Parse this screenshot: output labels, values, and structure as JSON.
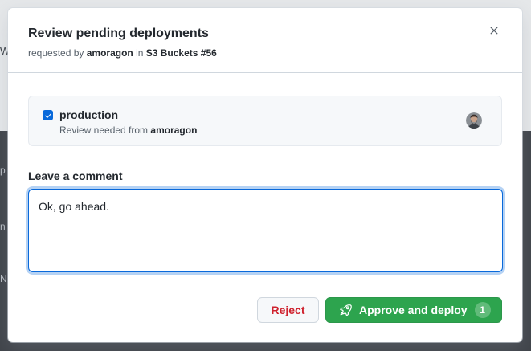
{
  "modal": {
    "title": "Review pending deployments",
    "subtitle": {
      "prefix": "requested by ",
      "user": "amoragon",
      "middle": " in ",
      "workflow": "S3 Buckets #56"
    },
    "close_icon": "close-icon"
  },
  "environment": {
    "checked": true,
    "name": "production",
    "review_prefix": "Review needed from ",
    "reviewer": "amoragon",
    "avatar_icon": "avatar"
  },
  "comment": {
    "label": "Leave a comment",
    "value": "Ok, go ahead."
  },
  "actions": {
    "reject_label": "Reject",
    "approve_label": "Approve and deploy",
    "approve_count": "1",
    "approve_icon": "rocket-icon"
  },
  "background": {
    "fragments": [
      "Wi",
      "p",
      "n",
      "N"
    ]
  },
  "colors": {
    "primary_green": "#2da44e",
    "danger_red": "#cf222e",
    "focus_blue": "#0969da"
  }
}
